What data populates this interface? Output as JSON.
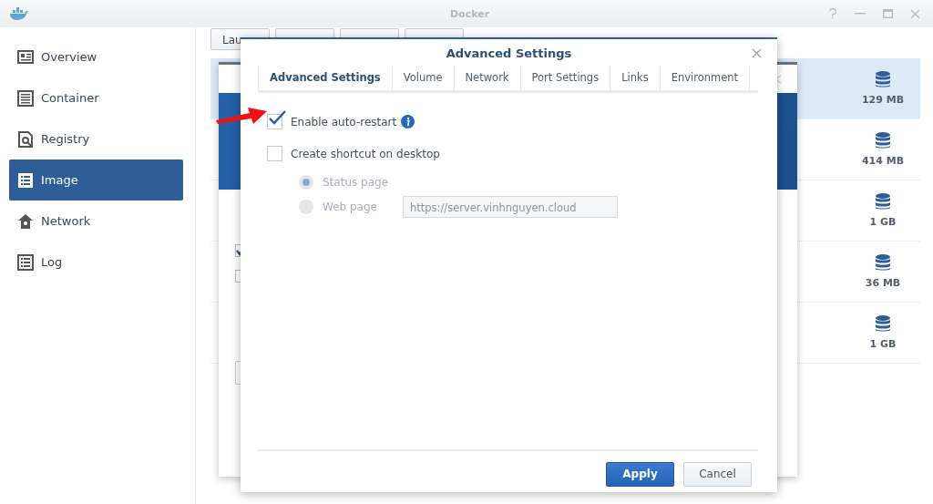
{
  "window": {
    "title": "Docker"
  },
  "sidebar": {
    "items": [
      {
        "label": "Overview",
        "selected": false
      },
      {
        "label": "Container",
        "selected": false
      },
      {
        "label": "Registry",
        "selected": false
      },
      {
        "label": "Image",
        "selected": true
      },
      {
        "label": "Network",
        "selected": false
      },
      {
        "label": "Log",
        "selected": false
      }
    ]
  },
  "toolbar": {
    "first_button": "Lau"
  },
  "background_dialog": {
    "checkboxes": [
      {
        "checked": true
      },
      {
        "checked": false
      }
    ]
  },
  "image_list": {
    "rows": [
      {
        "size": "129 MB",
        "selected": true
      },
      {
        "size": "414 MB",
        "selected": false
      },
      {
        "size": "1 GB",
        "selected": false
      },
      {
        "size": "36 MB",
        "selected": false
      },
      {
        "size": "1 GB",
        "selected": false
      }
    ]
  },
  "dialog": {
    "title": "Advanced Settings",
    "tabs": [
      {
        "label": "Advanced Settings",
        "selected": true
      },
      {
        "label": "Volume",
        "selected": false
      },
      {
        "label": "Network",
        "selected": false
      },
      {
        "label": "Port Settings",
        "selected": false
      },
      {
        "label": "Links",
        "selected": false
      },
      {
        "label": "Environment",
        "selected": false
      }
    ],
    "options": [
      {
        "kind": "checkbox",
        "label": "Enable auto-restart",
        "checked": true,
        "info": true
      },
      {
        "kind": "checkbox",
        "label": "Create shortcut on desktop",
        "checked": false
      },
      {
        "kind": "radio",
        "label": "Status page",
        "selected": true,
        "disabled": true
      },
      {
        "kind": "radio",
        "label": "Web page",
        "selected": false,
        "disabled": true,
        "field_value": "https://server.vinhnguyen.cloud"
      }
    ],
    "buttons": [
      {
        "label": "Apply",
        "kind": "primary"
      },
      {
        "label": "Cancel",
        "kind": "secondary"
      }
    ]
  }
}
